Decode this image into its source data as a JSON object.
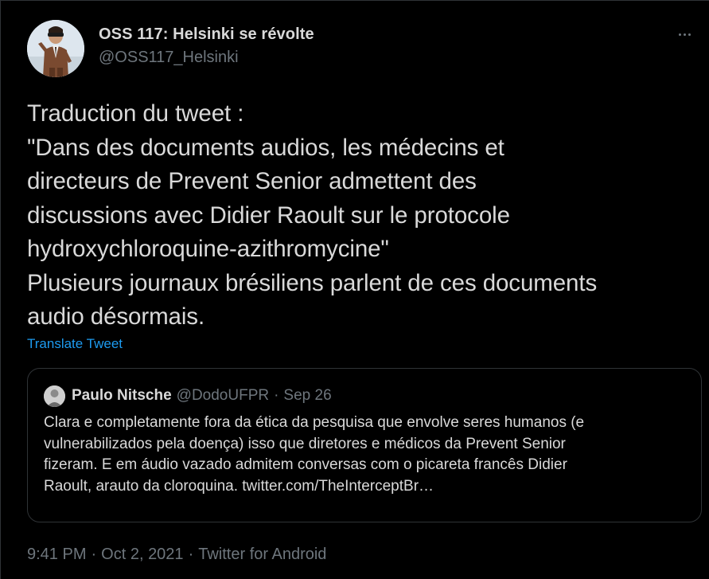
{
  "tweet": {
    "author": {
      "display_name": "OSS 117: Helsinki se révolte",
      "handle": "@OSS117_Helsinki",
      "avatar_icon": "user-avatar"
    },
    "more_icon": "more-options-icon",
    "body_lines": [
      "Traduction du tweet :",
      "\"Dans des documents audios, les médecins et",
      "directeurs de Prevent Senior admettent des",
      "discussions avec Didier Raoult sur le protocole",
      "hydroxychloroquine-azithromycine\"",
      "Plusieurs journaux brésiliens parlent de ces documents",
      "audio désormais."
    ],
    "translate_label": "Translate Tweet",
    "quoted": {
      "display_name": "Paulo Nitsche",
      "handle": "@DodoUFPR",
      "separator": "·",
      "date": "Sep 26",
      "text_lines": [
        "Clara e completamente fora da ética da pesquisa que envolve seres humanos (e",
        "vulnerabilizados pela doença) isso que diretores e médicos da Prevent Senior",
        "fizeram. E em áudio vazado admitem conversas com o picareta francês Didier",
        "Raoult, arauto da cloroquina. twitter.com/TheInterceptBr…"
      ]
    },
    "meta": {
      "time": "9:41 PM",
      "separator": "·",
      "date": "Oct 2, 2021",
      "source": "Twitter for Android"
    }
  },
  "colors": {
    "background": "#000000",
    "text": "#d9d9d9",
    "secondary": "#6e767d",
    "link": "#1d9bf0",
    "border": "#2f3336"
  }
}
